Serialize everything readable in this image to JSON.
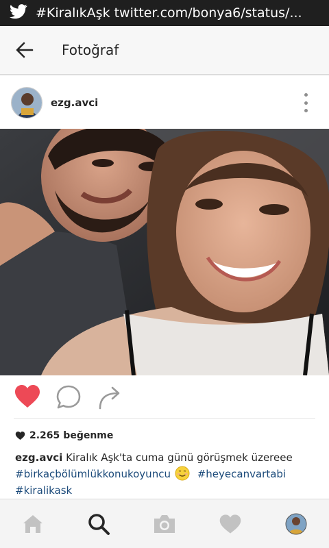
{
  "statusbar": {
    "icon": "twitter-bird-icon",
    "text": "#KiralıkAşk twitter.com/bonya6/status/..."
  },
  "appbar": {
    "back_icon": "arrow-left-icon",
    "title": "Fotoğraf"
  },
  "post": {
    "username": "ezg.avci",
    "more_icon": "more-vertical-icon"
  },
  "actions": {
    "like_icon": "heart-filled-icon",
    "comment_icon": "comment-bubble-icon",
    "share_icon": "share-arrow-icon"
  },
  "likes": {
    "count": "2.265",
    "label": "beğenme"
  },
  "caption": {
    "username": "ezg.avci",
    "text": "Kiralık Aşk'ta cuma günü görüşmek üzereee",
    "hashtags": [
      "#birkaçbölümlükkonukoyuncu",
      "#heyecanvartabi",
      "#kiralikask"
    ],
    "emoji": "smiling-face-emoji"
  },
  "tabbar": {
    "items": [
      "home-icon",
      "search-icon",
      "camera-icon",
      "heart-icon",
      "profile-avatar"
    ]
  },
  "colors": {
    "like_red": "#ed4956",
    "hashtag_blue": "#1b4a7a",
    "statusbar_bg": "#1f1f1f"
  }
}
